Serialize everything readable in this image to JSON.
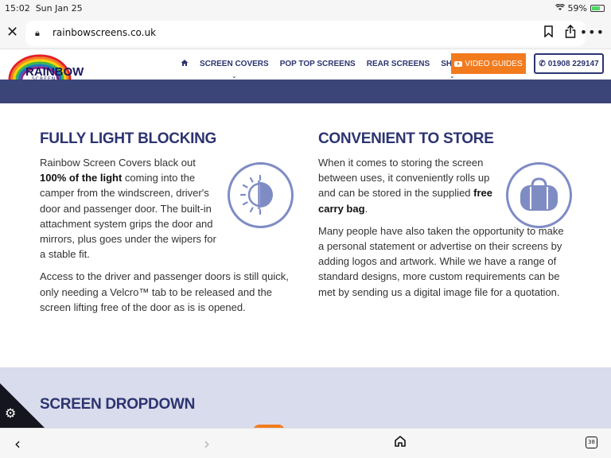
{
  "status": {
    "time": "15:02",
    "date": "Sun Jan 25",
    "battery": "59%"
  },
  "browser": {
    "url": "rainbowscreens.co.uk",
    "tab_count": "38"
  },
  "brand": {
    "name": "RAINBOW",
    "sub": "SCREENS"
  },
  "nav": {
    "items": [
      {
        "label": "SCREEN COVERS",
        "has_dropdown": true
      },
      {
        "label": "POP TOP SCREENS",
        "has_dropdown": false
      },
      {
        "label": "REAR SCREENS",
        "has_dropdown": false
      },
      {
        "label": "SHOP",
        "has_dropdown": true
      }
    ],
    "video_label": "VIDEO GUIDES",
    "phone_label": "01908 229147"
  },
  "light_blocking": {
    "heading": "FULLY LIGHT BLOCKING",
    "p1_before": "Rainbow Screen Covers black out ",
    "p1_bold": "100% of the light",
    "p1_after": " coming into the camper from the windscreen, driver's door and passenger door. The built-in attachment system grips the door and mirrors, plus goes under the wipers for a stable fit.",
    "p2": "Access to the driver and passenger doors is still quick, only needing a Velcro™ tab to be released and the screen lifting free of the door as is is opened."
  },
  "storage": {
    "heading": "CONVENIENT TO STORE",
    "p1_before": "When it comes to storing the screen between uses, it conveniently rolls up and can be stored in the supplied ",
    "p1_bold": "free carry bag",
    "p1_after": ".",
    "p2": "Many people have also taken the opportunity to make a personal statement or advertise on their screens by adding logos and artwork. While we have a range of standard designs, more custom requirements can be met by sending us a digital image file for a quotation."
  },
  "dropdown_section": {
    "heading": "SCREEN DROPDOWN"
  },
  "colors": {
    "navy": "#2c3470",
    "band": "#3c4577",
    "accent": "#f27b1e",
    "icon": "#7f8cc4",
    "section_bg": "#d9dcec"
  },
  "icons": [
    "close-icon",
    "lock-icon",
    "bookmark-icon",
    "share-icon",
    "more-icon",
    "home-icon",
    "phone-icon",
    "video-icon",
    "sun-shade-icon",
    "carry-bag-icon",
    "gear-icon",
    "back-icon",
    "forward-icon",
    "tabs-icon",
    "wifi-icon",
    "battery-icon"
  ]
}
